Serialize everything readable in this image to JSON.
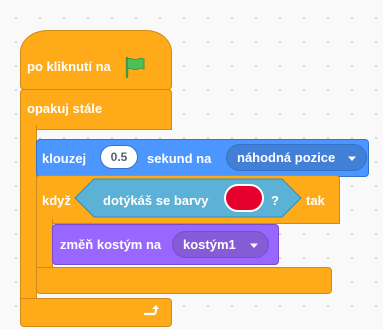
{
  "colors": {
    "control": "#ffab19",
    "control_border": "#cf8b17",
    "motion": "#4c97ff",
    "motion_dark": "#4280d7",
    "sensing": "#5cb1d6",
    "sensing_border": "#2e8eb8",
    "looks": "#9966ff",
    "looks_dark": "#855cd6",
    "flag_green": "#4cbf56",
    "picked_color": "#e6002e"
  },
  "hat_block": {
    "label": "po kliknutí na",
    "icon": "green-flag-icon"
  },
  "forever_block": {
    "label": "opakuj stále",
    "loop_icon": "loop-arrow-icon"
  },
  "glide_block": {
    "label_before": "klouzej",
    "seconds_value": "0.5",
    "label_after": "sekund na",
    "target_option": "náhodná pozice"
  },
  "if_block": {
    "label_if": "když",
    "label_then": "tak"
  },
  "touching_color_block": {
    "label": "dotýkáš se barvy",
    "question_mark": "?"
  },
  "switch_costume_block": {
    "label": "změň kostým na",
    "costume_option": "kostým1"
  }
}
